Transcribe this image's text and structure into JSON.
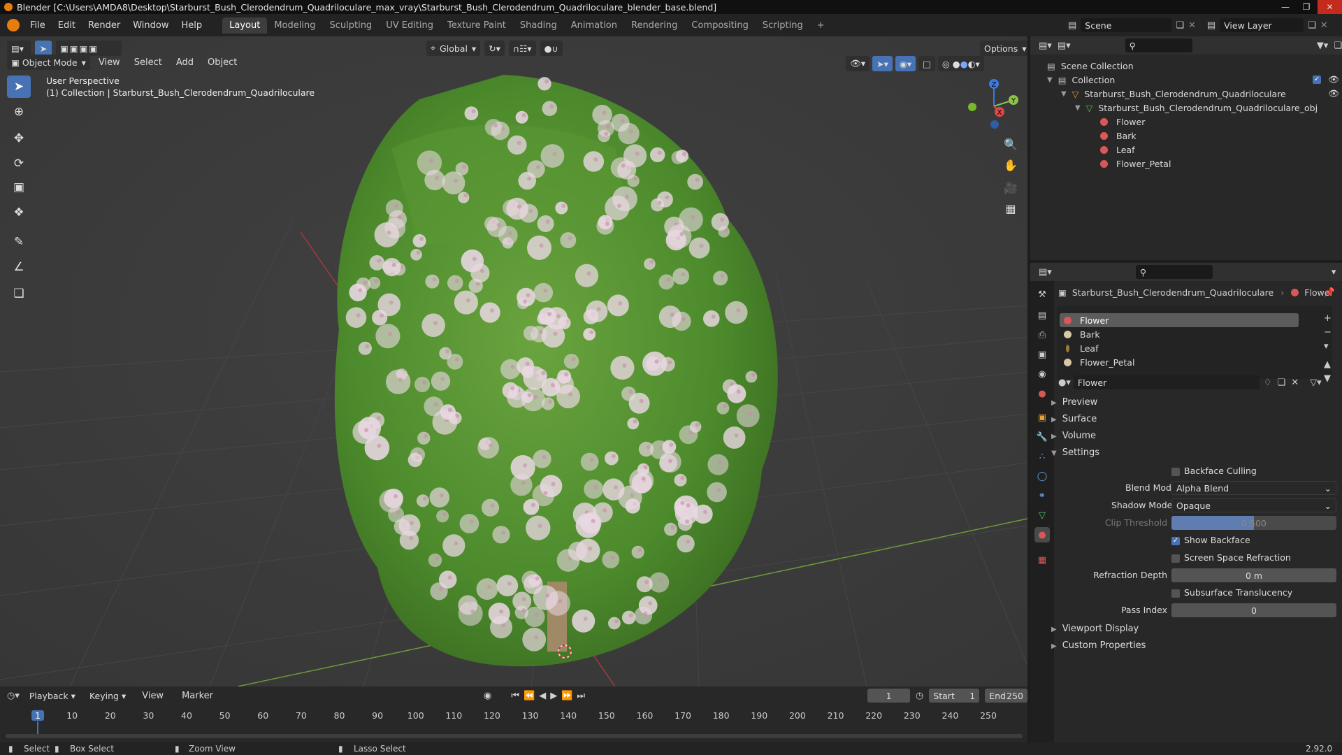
{
  "window": {
    "title": "Blender [C:\\Users\\AMDA8\\Desktop\\Starburst_Bush_Clerodendrum_Quadriloculare_max_vray\\Starburst_Bush_Clerodendrum_Quadriloculare_blender_base.blend]"
  },
  "topbar": {
    "menus": [
      "File",
      "Edit",
      "Render",
      "Window",
      "Help"
    ],
    "workspaces": [
      "Layout",
      "Modeling",
      "Sculpting",
      "UV Editing",
      "Texture Paint",
      "Shading",
      "Animation",
      "Rendering",
      "Compositing",
      "Scripting"
    ],
    "active_workspace": "Layout",
    "add_tab": "+",
    "scene": "Scene",
    "view_layer": "View Layer"
  },
  "viewport": {
    "mode": "Object Mode",
    "menus": [
      "View",
      "Select",
      "Add",
      "Object"
    ],
    "orientation": "Global",
    "options": "Options",
    "overlay_title": "User Perspective",
    "overlay_subtitle": "(1) Collection | Starburst_Bush_Clerodendrum_Quadriloculare",
    "gizmo": {
      "z": "Z",
      "y": "Y",
      "x": "X"
    }
  },
  "outliner": {
    "root": "Scene Collection",
    "collection": "Collection",
    "object": "Starburst_Bush_Clerodendrum_Quadriloculare",
    "mesh": "Starburst_Bush_Clerodendrum_Quadriloculare_obj",
    "materials": [
      "Flower",
      "Bark",
      "Leaf",
      "Flower_Petal"
    ]
  },
  "properties": {
    "breadcrumb_object": "Starburst_Bush_Clerodendrum_Quadriloculare",
    "breadcrumb_material": "Flower",
    "slots": [
      "Flower",
      "Bark",
      "Leaf",
      "Flower_Petal"
    ],
    "material_name": "Flower",
    "panels": {
      "preview": "Preview",
      "surface": "Surface",
      "volume": "Volume",
      "settings": "Settings",
      "viewport_display": "Viewport Display",
      "custom_properties": "Custom Properties"
    },
    "settings": {
      "backface_culling": "Backface Culling",
      "blend_mode_label": "Blend Mode",
      "blend_mode": "Alpha Blend",
      "shadow_mode_label": "Shadow Mode",
      "shadow_mode": "Opaque",
      "clip_threshold_label": "Clip Threshold",
      "clip_threshold": "0.500",
      "show_backface": "Show Backface",
      "show_backface_checked": true,
      "screen_space_refraction": "Screen Space Refraction",
      "refraction_depth_label": "Refraction Depth",
      "refraction_depth": "0 m",
      "subsurface_translucency": "Subsurface Translucency",
      "pass_index_label": "Pass Index",
      "pass_index": "0"
    }
  },
  "timeline": {
    "menus": [
      "Playback",
      "Keying",
      "View",
      "Marker"
    ],
    "current_frame": "1",
    "start_label": "Start",
    "start": "1",
    "end_label": "End",
    "end": "250",
    "ticks": [
      "1",
      "10",
      "20",
      "30",
      "40",
      "50",
      "60",
      "70",
      "80",
      "90",
      "100",
      "110",
      "120",
      "130",
      "140",
      "150",
      "160",
      "170",
      "180",
      "190",
      "200",
      "210",
      "220",
      "230",
      "240",
      "250"
    ]
  },
  "statusbar": {
    "select": "Select",
    "box_select": "Box Select",
    "zoom_view": "Zoom View",
    "lasso_select": "Lasso Select",
    "version": "2.92.0"
  },
  "colors": {
    "accent": "#4772b3",
    "leaf": "#4f8a2f",
    "flower": "#e9d8e2",
    "grid": "#3a3a3a"
  }
}
